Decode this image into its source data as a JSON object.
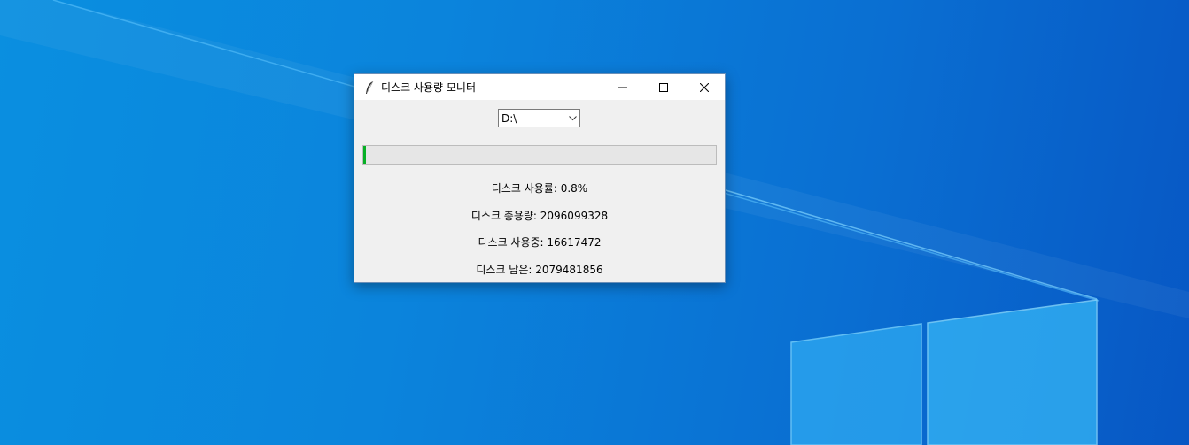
{
  "window": {
    "title": "디스크 사용량 모니터",
    "app_icon": "feather-icon"
  },
  "title_controls": {
    "minimize_icon": "minimize-icon",
    "maximize_icon": "maximize-icon",
    "close_icon": "close-icon"
  },
  "drive_select": {
    "value": "D:\\",
    "arrow_icon": "chevron-down-icon"
  },
  "progress": {
    "percent": 0.8
  },
  "stats": {
    "usage_percent": "디스크 사용률: 0.8%",
    "total": "디스크 총용량: 2096099328",
    "used": "디스크 사용중: 16617472",
    "free": "디스크 남은: 2079481856"
  },
  "colors": {
    "progress_fill": "#06b025",
    "window_bg": "#f0f0f0",
    "desktop_blue": "#0a8fe0"
  }
}
